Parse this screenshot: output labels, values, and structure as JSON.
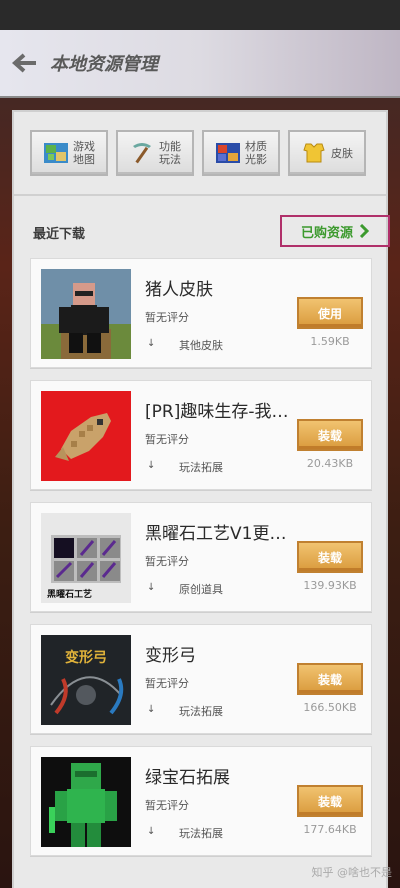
{
  "header": {
    "title": "本地资源管理"
  },
  "tabs": [
    {
      "icon": "map-icon",
      "label": "游戏\n地图"
    },
    {
      "icon": "pickaxe-icon",
      "label": "功能\n玩法"
    },
    {
      "icon": "texture-icon",
      "label": "材质\n光影"
    },
    {
      "icon": "armor-icon",
      "label": "皮肤"
    }
  ],
  "section": {
    "title": "最近下载",
    "purchased_label": "已购资源"
  },
  "items": [
    {
      "title": "猪人皮肤",
      "rating": "暂无评分",
      "category": "其他皮肤",
      "action": "使用",
      "size": "1.59KB"
    },
    {
      "title": "[PR]趣味生存-我…",
      "rating": "暂无评分",
      "category": "玩法拓展",
      "action": "装载",
      "size": "20.43KB"
    },
    {
      "title": "黑曜石工艺V1更…",
      "rating": "暂无评分",
      "category": "原创道具",
      "action": "装载",
      "size": "139.93KB",
      "thumb_caption": "黑曜石工艺"
    },
    {
      "title": "变形弓",
      "rating": "暂无评分",
      "category": "玩法拓展",
      "action": "装载",
      "size": "166.50KB",
      "thumb_caption": "变形弓"
    },
    {
      "title": "绿宝石拓展",
      "rating": "暂无评分",
      "category": "玩法拓展",
      "action": "装载",
      "size": "177.64KB"
    }
  ],
  "watermark": "知乎 @啥也不是",
  "colors": {
    "accent_green": "#3c9a2e",
    "button_orange": "#e0a448",
    "highlight_border": "#b0306a"
  }
}
